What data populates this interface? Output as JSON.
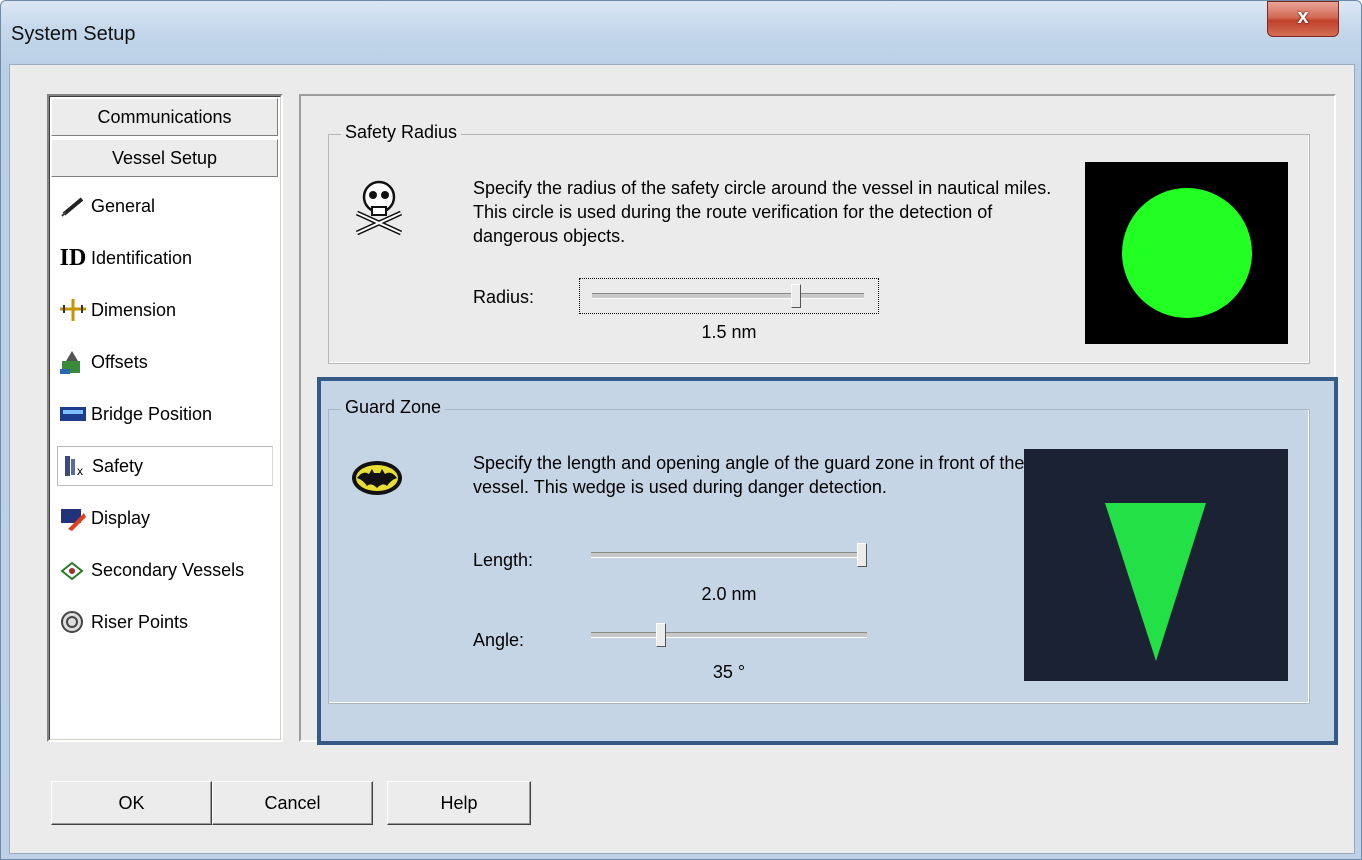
{
  "window": {
    "title": "System Setup",
    "close_glyph": "x"
  },
  "sidebar": {
    "categories": [
      {
        "label": "Communications"
      },
      {
        "label": "Vessel Setup"
      }
    ],
    "items": [
      {
        "label": "General",
        "icon": "pen-icon"
      },
      {
        "label": "Identification",
        "icon": "id-icon"
      },
      {
        "label": "Dimension",
        "icon": "dimension-icon"
      },
      {
        "label": "Offsets",
        "icon": "offsets-icon"
      },
      {
        "label": "Bridge Position",
        "icon": "bridge-icon"
      },
      {
        "label": "Safety",
        "icon": "safety-icon",
        "selected": true
      },
      {
        "label": "Display",
        "icon": "display-icon"
      },
      {
        "label": "Secondary Vessels",
        "icon": "vessels-icon"
      },
      {
        "label": "Riser Points",
        "icon": "riser-icon"
      }
    ]
  },
  "safety_radius": {
    "title": "Safety Radius",
    "icon": "skull-crossbones-icon",
    "description": "Specify the radius of the safety circle around the vessel in nautical miles. This circle is used during the route verification for the detection of dangerous objects.",
    "radius_label": "Radius:",
    "radius_value": "1.5 nm",
    "radius_slider_fraction": 0.75,
    "preview_color": "#22ff22",
    "preview_bg": "#000000"
  },
  "guard_zone": {
    "title": "Guard Zone",
    "icon": "batman-icon",
    "description": "Specify the length and opening angle of the guard zone in front of the vessel. This wedge is used during danger detection.",
    "length_label": "Length:",
    "length_value": "2.0 nm",
    "length_slider_fraction": 1.0,
    "angle_label": "Angle:",
    "angle_value": "35 °",
    "angle_slider_fraction": 0.25,
    "preview_color": "#22e046",
    "preview_bg": "#1a2233",
    "highlight_color": "#355a86"
  },
  "buttons": {
    "ok": "OK",
    "cancel": "Cancel",
    "help": "Help"
  }
}
